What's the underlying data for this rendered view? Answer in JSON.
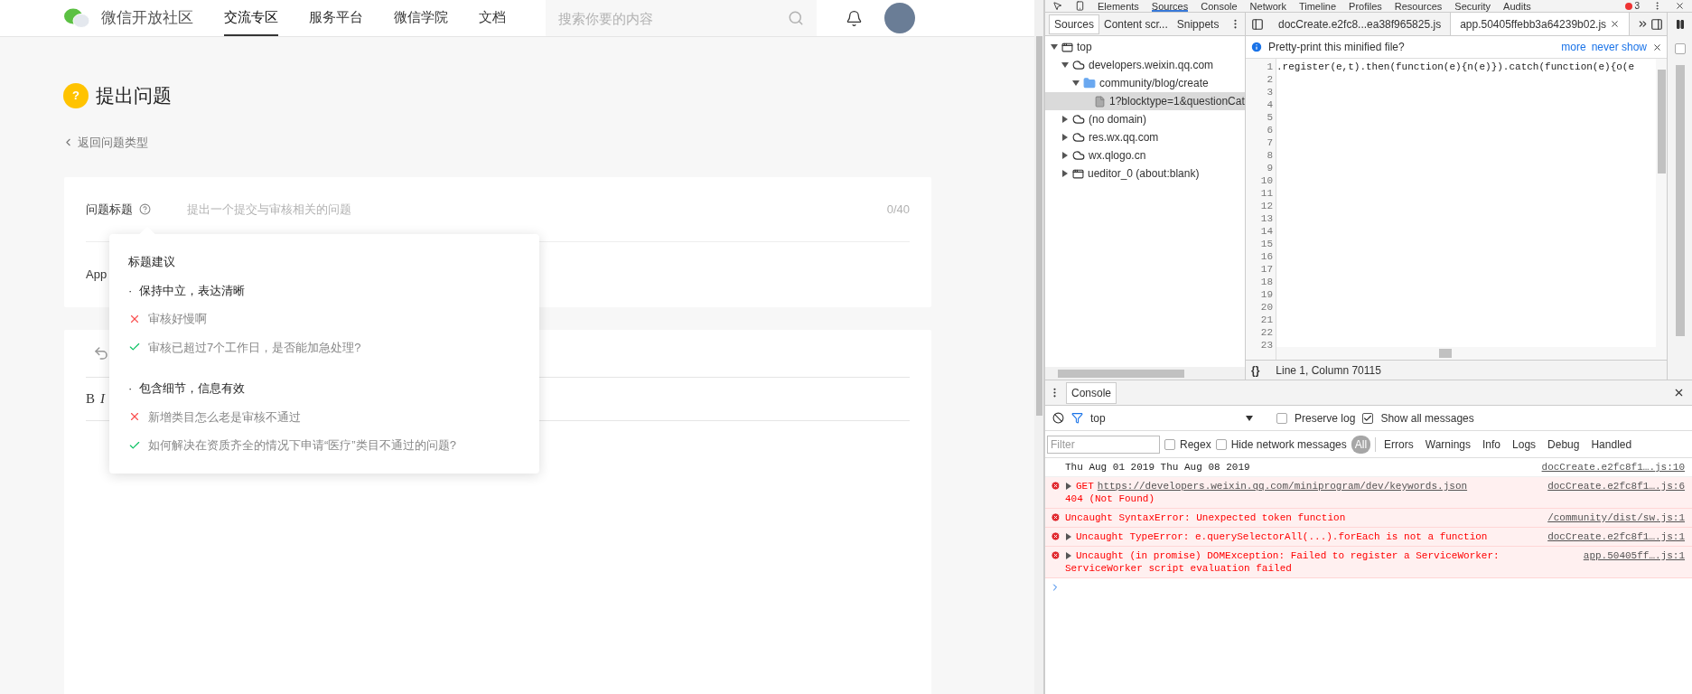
{
  "site": {
    "name": "微信开放社区",
    "nav": [
      {
        "label": "交流专区",
        "selected": true
      },
      {
        "label": "服务平台",
        "selected": false
      },
      {
        "label": "微信学院",
        "selected": false
      },
      {
        "label": "文档",
        "selected": false
      }
    ],
    "search": {
      "placeholder": "搜索你要的内容"
    }
  },
  "page": {
    "icon_glyph": "?",
    "title": "提出问题",
    "back_link": "返回问题类型",
    "title_field": {
      "label": "问题标题",
      "placeholder": "提出一个提交与审核相关的问题",
      "counter": "0/40"
    },
    "row_2_label": "App",
    "editor_toolbar": [
      "B",
      "I"
    ]
  },
  "tooltip": {
    "title": "标题建议",
    "sections": [
      {
        "heading": "·  保持中立，表达清晰",
        "examples": [
          {
            "text": "审核好慢啊",
            "good": false
          },
          {
            "text": "审核已超过7个工作日，是否能加急处理?",
            "good": true
          }
        ]
      },
      {
        "heading": "·  包含细节，信息有效",
        "examples": [
          {
            "text": "新增类目怎么老是审核不通过",
            "good": false
          },
          {
            "text": "如何解决在资质齐全的情况下申请“医疗”类目不通过的问题?",
            "good": true
          }
        ]
      }
    ]
  },
  "devtools": {
    "main_tabs": [
      {
        "label": "Elements",
        "selected": false
      },
      {
        "label": "Sources",
        "selected": true
      },
      {
        "label": "Console",
        "selected": false
      },
      {
        "label": "Network",
        "selected": false
      },
      {
        "label": "Timeline",
        "selected": false
      },
      {
        "label": "Profiles",
        "selected": false
      },
      {
        "label": "Resources",
        "selected": false
      },
      {
        "label": "Security",
        "selected": false
      },
      {
        "label": "Audits",
        "selected": false
      }
    ],
    "error_count": "3",
    "navigator_tabs": [
      {
        "label": "Sources",
        "selected": true
      },
      {
        "label": "Content scr...",
        "selected": false
      },
      {
        "label": "Snippets",
        "selected": false
      }
    ],
    "tree": [
      {
        "label": "top",
        "kind": "frame",
        "expanded": true,
        "selected": false,
        "children": [
          {
            "label": "developers.weixin.qq.com",
            "kind": "domain",
            "expanded": true,
            "selected": false,
            "children": [
              {
                "label": "community/blog/create",
                "kind": "folder",
                "expanded": true,
                "selected": false,
                "children": [
                  {
                    "label": "1?blocktype=1&questionCat",
                    "kind": "file",
                    "selected": true
                  }
                ]
              }
            ]
          },
          {
            "label": "(no domain)",
            "kind": "domain",
            "expanded": false,
            "selected": false
          },
          {
            "label": "res.wx.qq.com",
            "kind": "domain",
            "expanded": false,
            "selected": false
          },
          {
            "label": "wx.qlogo.cn",
            "kind": "domain",
            "expanded": false,
            "selected": false
          },
          {
            "label": "ueditor_0 (about:blank)",
            "kind": "frame",
            "expanded": false,
            "selected": false
          }
        ]
      }
    ],
    "file_tabs": [
      {
        "label": "docCreate.e2fc8...ea38f965825.js",
        "selected": false
      },
      {
        "label": "app.50405ffebb3a64239b02.js",
        "selected": true
      }
    ],
    "debugger_checkbox": {
      "checked": false
    },
    "infobar": {
      "message": "Pretty-print this minified file?",
      "links": [
        "more",
        "never show"
      ]
    },
    "line_numbers": [
      "1",
      "2",
      "3",
      "4",
      "5",
      "6",
      "7",
      "8",
      "9",
      "10",
      "11",
      "12",
      "13",
      "14",
      "15",
      "16",
      "17",
      "18",
      "19",
      "20",
      "21",
      "22",
      "23"
    ],
    "code_line": ".register(e,t).then(function(e){n(e)}).catch(function(e){o(e",
    "status": {
      "format_button": "{}",
      "position": "Line 1, Column 70115"
    },
    "console": {
      "tab": "Console",
      "context": "top",
      "preserve_log": {
        "label": "Preserve log",
        "checked": false
      },
      "show_all": {
        "label": "Show all messages",
        "checked": true
      },
      "filter_placeholder": "Filter",
      "regex": {
        "label": "Regex",
        "checked": false
      },
      "hide_network": {
        "label": "Hide network messages",
        "checked": false
      },
      "levels": [
        {
          "label": "All",
          "selected": true
        },
        {
          "label": "Errors",
          "selected": false
        },
        {
          "label": "Warnings",
          "selected": false
        },
        {
          "label": "Info",
          "selected": false
        },
        {
          "label": "Logs",
          "selected": false
        },
        {
          "label": "Debug",
          "selected": false
        },
        {
          "label": "Handled",
          "selected": false
        }
      ],
      "messages": [
        {
          "kind": "log",
          "expandable": false,
          "text": "Thu Aug 01 2019 Thu Aug 08 2019",
          "source": "docCreate.e2fc8f1….js:10"
        },
        {
          "kind": "error",
          "expandable": true,
          "text": "GET",
          "link": "https://developers.weixin.qq.com/miniprogram/dev/keywords.json",
          "continuation": "404 (Not Found)",
          "source": "docCreate.e2fc8f1….js:6"
        },
        {
          "kind": "error",
          "expandable": false,
          "text": "Uncaught SyntaxError: Unexpected token function",
          "source": "/community/dist/sw.js:1"
        },
        {
          "kind": "error",
          "expandable": true,
          "text": "Uncaught TypeError: e.querySelectorAll(...).forEach is not a function",
          "source": "docCreate.e2fc8f1….js:1"
        },
        {
          "kind": "error",
          "expandable": true,
          "text": "Uncaught (in promise) DOMException: Failed to register a ServiceWorker:",
          "continuation": "ServiceWorker script evaluation failed",
          "source": "app.50405ff….js:1"
        }
      ]
    }
  }
}
